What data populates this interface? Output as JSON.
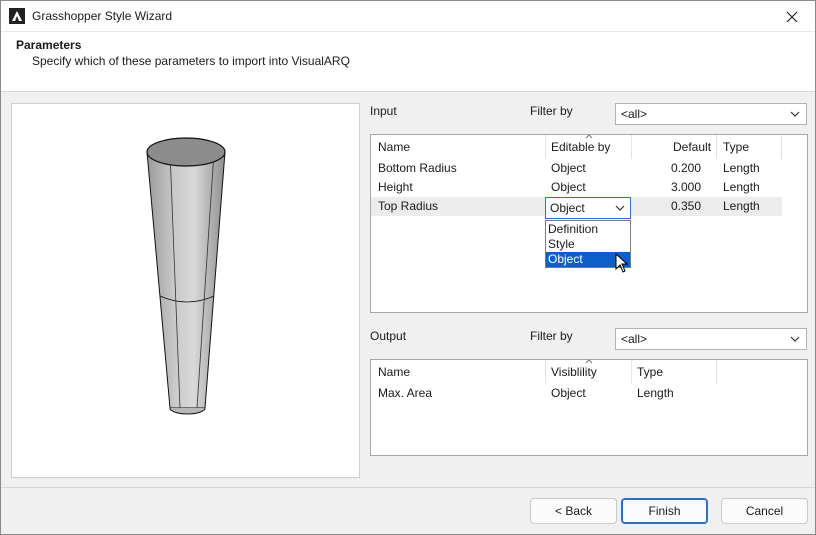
{
  "window": {
    "title": "Grasshopper Style Wizard"
  },
  "header": {
    "title": "Parameters",
    "subtitle": "Specify which of these parameters to import into VisualARQ"
  },
  "input": {
    "label": "Input",
    "filter_label": "Filter by",
    "filter_value": "<all>",
    "columns": [
      "Name",
      "Editable by",
      "Default",
      "Type"
    ],
    "rows": [
      {
        "name": "Bottom Radius",
        "editable_by": "Object",
        "default": "0.200",
        "type": "Length"
      },
      {
        "name": "Height",
        "editable_by": "Object",
        "default": "3.000",
        "type": "Length"
      },
      {
        "name": "Top Radius",
        "editable_by": "Object",
        "default": "0.350",
        "type": "Length"
      }
    ],
    "editing_combo_value": "Object",
    "dropdown_options": [
      "Definition",
      "Style",
      "Object"
    ],
    "dropdown_selected": "Object"
  },
  "output": {
    "label": "Output",
    "filter_label": "Filter by",
    "filter_value": "<all>",
    "columns": [
      "Name",
      "Visiblility",
      "Type"
    ],
    "rows": [
      {
        "name": "Max. Area",
        "visibility": "Object",
        "type": "Length"
      }
    ]
  },
  "buttons": {
    "back": "< Back",
    "finish": "Finish",
    "cancel": "Cancel"
  },
  "colors": {
    "accent": "#0b5fc6",
    "window_bg": "#f0f0f0"
  }
}
